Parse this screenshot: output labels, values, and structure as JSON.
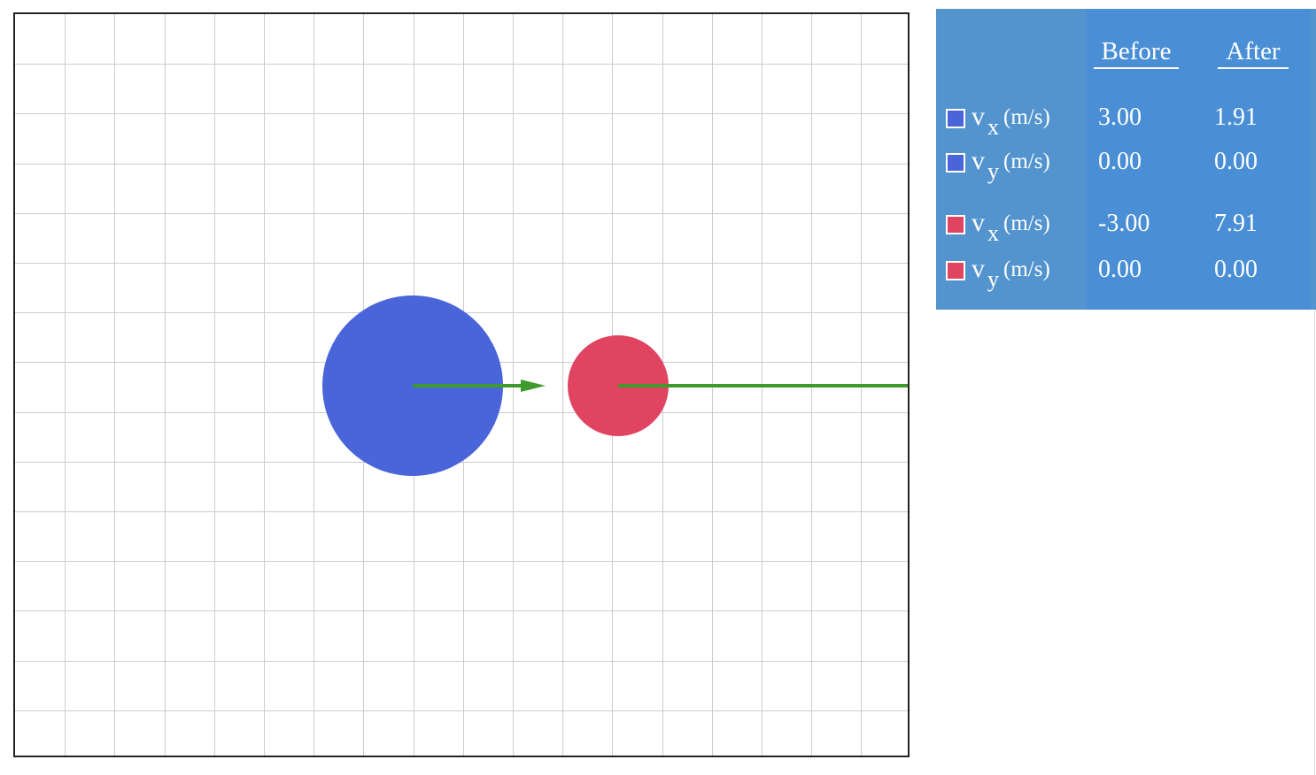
{
  "colors": {
    "blue_ball": "#4a64d9",
    "red_ball": "#e04460",
    "arrow": "#3e9a2c",
    "grid": "#cccccc",
    "panel": "#4a90d2"
  },
  "table": {
    "before_header": "Before",
    "after_header": "After",
    "rows": [
      {
        "ball": "blue",
        "symbol": "v",
        "subscript": "x",
        "unit": "(m/s)",
        "before": "3.00",
        "after": "1.91"
      },
      {
        "ball": "blue",
        "symbol": "v",
        "subscript": "y",
        "unit": "(m/s)",
        "before": "0.00",
        "after": "0.00"
      },
      {
        "ball": "red",
        "symbol": "v",
        "subscript": "x",
        "unit": "(m/s)",
        "before": "-3.00",
        "after": "7.91"
      },
      {
        "ball": "red",
        "symbol": "v",
        "subscript": "y",
        "unit": "(m/s)",
        "before": "0.00",
        "after": "0.00"
      }
    ]
  }
}
